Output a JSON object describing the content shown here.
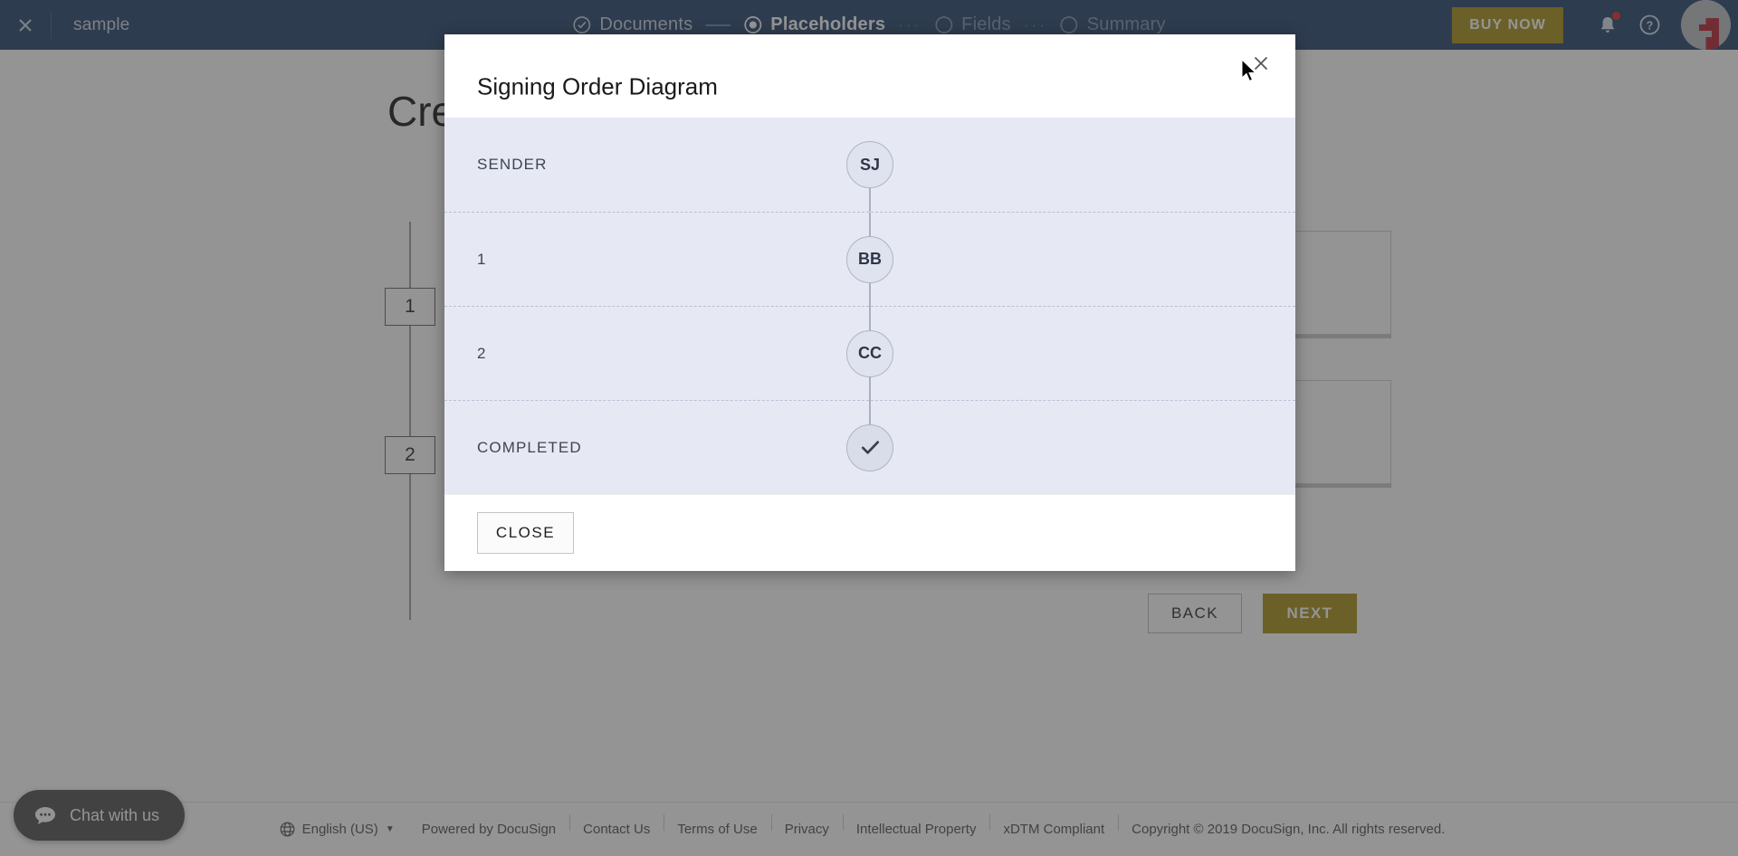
{
  "topbar": {
    "close_icon": "close-icon",
    "filename": "sample",
    "steps": [
      {
        "label": "Documents",
        "state": "done",
        "icon": "check-circle-icon"
      },
      {
        "label": "Placeholders",
        "state": "active",
        "icon": "target-circle-icon"
      },
      {
        "label": "Fields",
        "state": "todo",
        "icon": "empty-circle-icon"
      },
      {
        "label": "Summary",
        "state": "todo",
        "icon": "empty-circle-icon"
      }
    ],
    "buy_now_label": "BUY NOW",
    "notification_icon": "bell-icon",
    "help_icon": "help-circle-icon",
    "avatar": "user-avatar",
    "bg_color": "#1d3d66",
    "accent_color": "#a68d13"
  },
  "main": {
    "page_title": "Cre",
    "order_boxes": [
      "1",
      "2"
    ],
    "back_label": "BACK",
    "next_label": "NEXT"
  },
  "modal": {
    "title": "Signing Order Diagram",
    "close_icon": "close-icon",
    "close_button_label": "CLOSE",
    "rows": [
      {
        "label": "SENDER",
        "initials": "SJ",
        "type": "avatar"
      },
      {
        "label": "1",
        "initials": "BB",
        "type": "avatar"
      },
      {
        "label": "2",
        "initials": "CC",
        "type": "avatar"
      },
      {
        "label": "COMPLETED",
        "initials": "",
        "type": "check"
      }
    ]
  },
  "footer": {
    "globe_icon": "globe-icon",
    "language": "English (US)",
    "caret": "▼",
    "links": [
      "Powered by DocuSign",
      "Contact Us",
      "Terms of Use",
      "Privacy",
      "Intellectual Property",
      "xDTM Compliant"
    ],
    "copyright": "Copyright © 2019 DocuSign, Inc. All rights reserved."
  },
  "chat": {
    "icon": "chat-bubble-icon",
    "label": "Chat with us"
  }
}
